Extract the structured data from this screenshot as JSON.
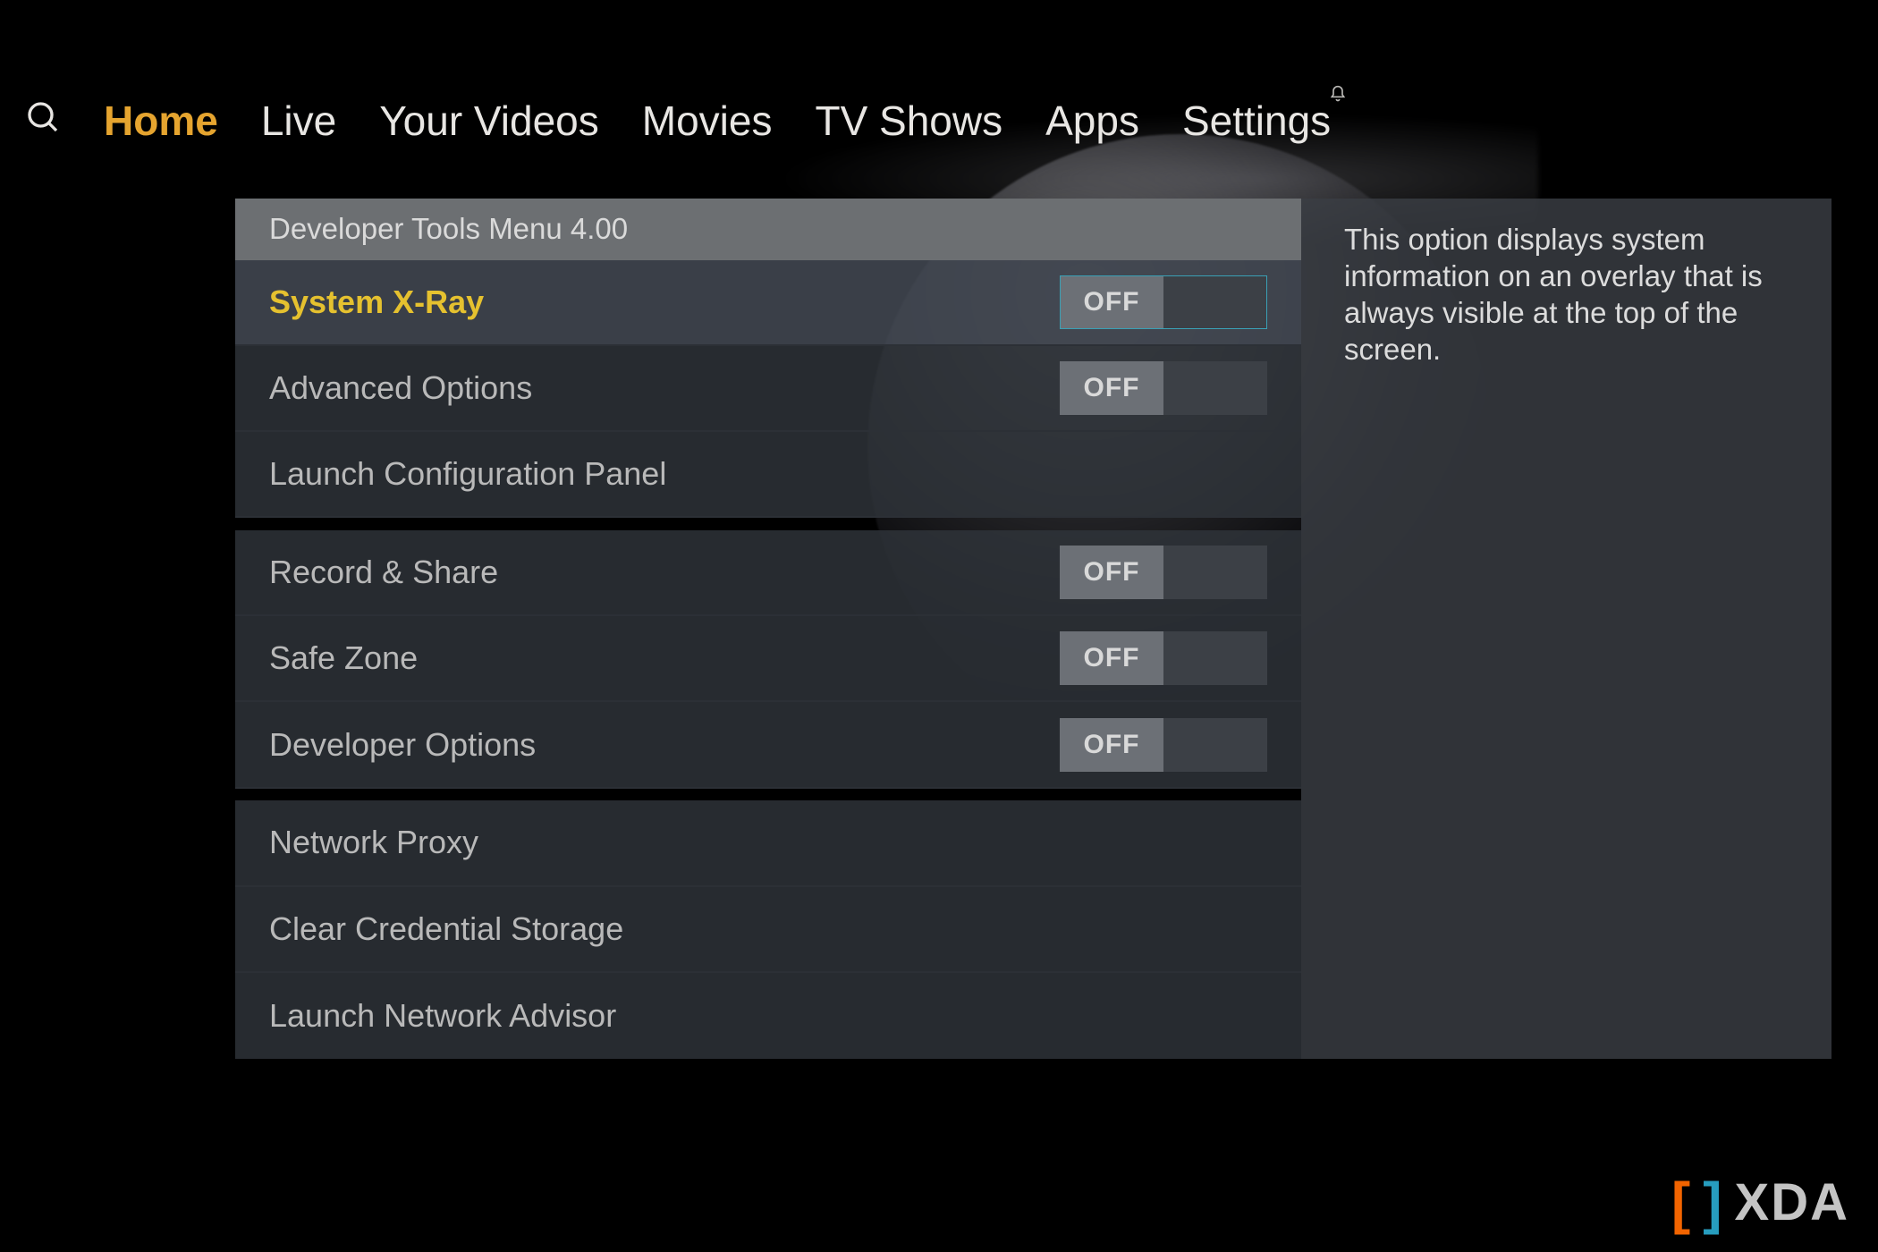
{
  "nav": {
    "items": [
      {
        "label": "Home",
        "active": true
      },
      {
        "label": "Live",
        "active": false
      },
      {
        "label": "Your Videos",
        "active": false
      },
      {
        "label": "Movies",
        "active": false
      },
      {
        "label": "TV Shows",
        "active": false
      },
      {
        "label": "Apps",
        "active": false
      },
      {
        "label": "Settings",
        "active": false
      }
    ]
  },
  "panel": {
    "header": "Developer Tools Menu 4.00",
    "info_text": "This option displays system information on an overlay that is always visible at the top of the screen.",
    "rows": [
      {
        "label": "System X-Ray",
        "toggle": "OFF",
        "selected": true
      },
      {
        "label": "Advanced Options",
        "toggle": "OFF",
        "selected": false
      },
      {
        "label": "Launch Configuration Panel",
        "toggle": null,
        "selected": false
      },
      {
        "label": "Record & Share",
        "toggle": "OFF",
        "selected": false
      },
      {
        "label": "Safe Zone",
        "toggle": "OFF",
        "selected": false
      },
      {
        "label": "Developer Options",
        "toggle": "OFF",
        "selected": false
      },
      {
        "label": "Network Proxy",
        "toggle": null,
        "selected": false
      },
      {
        "label": "Clear Credential Storage",
        "toggle": null,
        "selected": false
      },
      {
        "label": "Launch Network Advisor",
        "toggle": null,
        "selected": false
      }
    ]
  },
  "watermark": {
    "left": "[",
    "right": "]",
    "text": "XDA"
  }
}
